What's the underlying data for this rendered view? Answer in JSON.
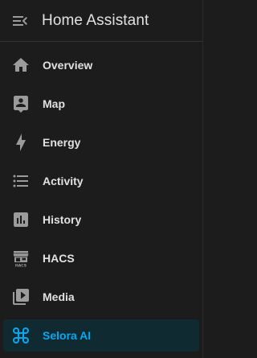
{
  "app": {
    "title": "Home Assistant"
  },
  "colors": {
    "background": "#1c1c1c",
    "text": "#e1e1e1",
    "icon": "#9b9b9b",
    "accent": "#03a9f4",
    "active_background": "#0f2a31"
  },
  "nav": {
    "items": [
      {
        "label": "Overview",
        "icon": "home-icon",
        "active": false
      },
      {
        "label": "Map",
        "icon": "map-icon",
        "active": false
      },
      {
        "label": "Energy",
        "icon": "lightning-bolt-icon",
        "active": false
      },
      {
        "label": "Activity",
        "icon": "format-list-bulleted-icon",
        "active": false
      },
      {
        "label": "History",
        "icon": "chart-box-icon",
        "active": false
      },
      {
        "label": "HACS",
        "icon": "hacs-icon",
        "active": false
      },
      {
        "label": "Media",
        "icon": "play-box-multiple-icon",
        "active": false
      },
      {
        "label": "Selora AI",
        "icon": "apple-keyboard-command-icon",
        "active": true
      }
    ]
  }
}
